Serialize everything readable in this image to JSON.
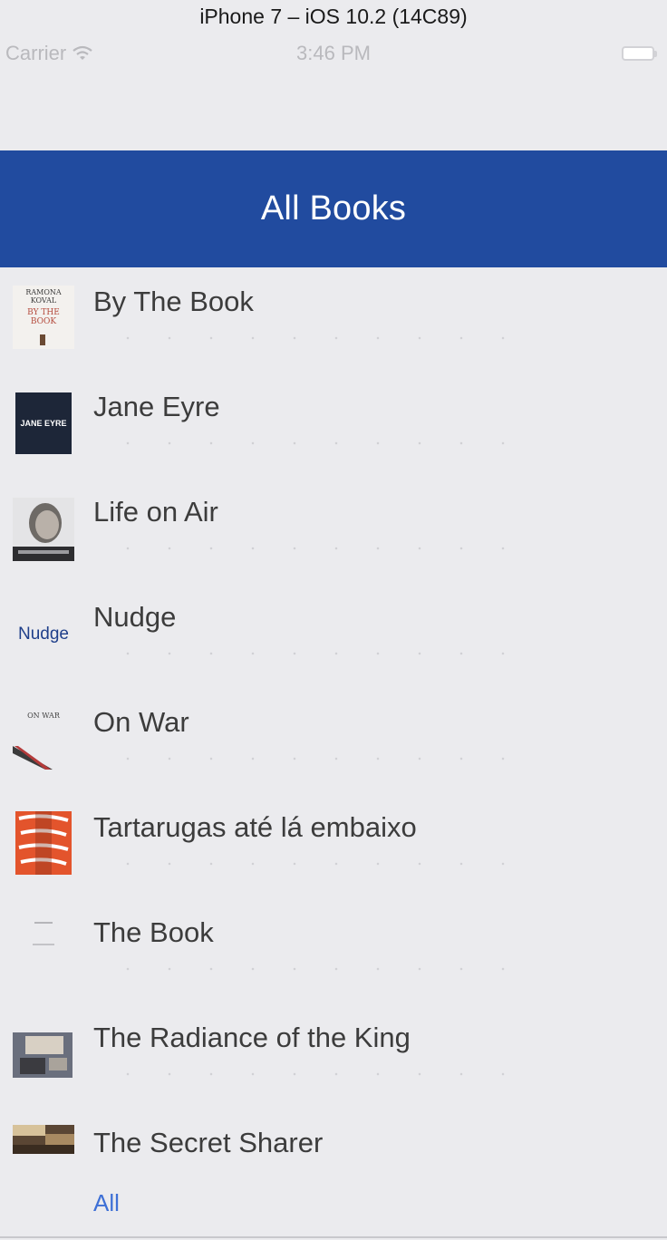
{
  "simulator": {
    "title": "iPhone 7 – iOS 10.2 (14C89)"
  },
  "status_bar": {
    "carrier": "Carrier",
    "time": "3:46 PM"
  },
  "nav": {
    "title": "All Books"
  },
  "books": [
    {
      "title": "By The Book",
      "cover_text": "RAMONA KOVAL"
    },
    {
      "title": "Jane Eyre",
      "cover_text": "JANE EYRE"
    },
    {
      "title": "Life on Air"
    },
    {
      "title": "Nudge",
      "cover_text": "Nudge"
    },
    {
      "title": "On War",
      "cover_text": "ON WAR"
    },
    {
      "title": "Tartarugas até lá embaixo"
    },
    {
      "title": "The Book"
    },
    {
      "title": "The Radiance of the King"
    },
    {
      "title": "The Secret Sharer"
    }
  ],
  "filter": {
    "label": "All"
  },
  "colors": {
    "nav_background": "#214b9f",
    "background": "#ebebee",
    "link": "#3e70d6"
  }
}
